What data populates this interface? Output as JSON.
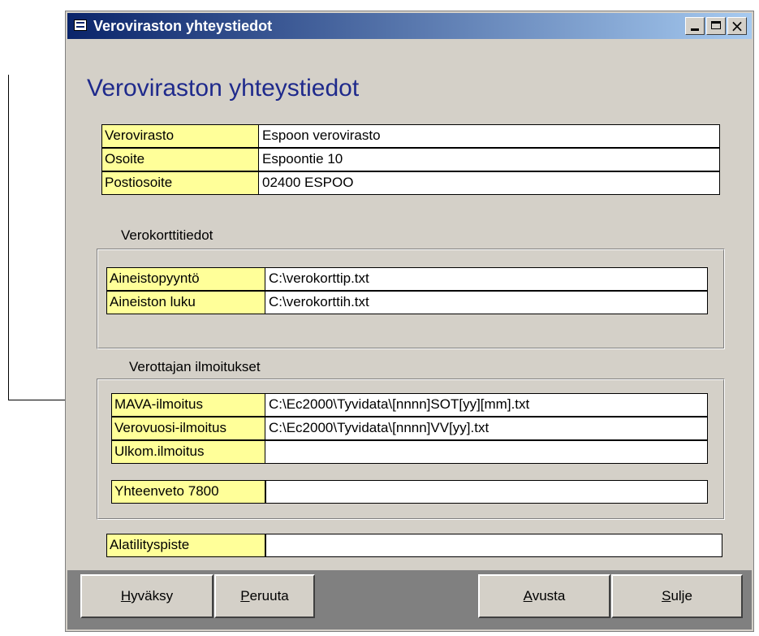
{
  "window": {
    "title": "Verovirastonyhteystiedot",
    "title_text": "Veroviraston yhteystiedot",
    "buttons": {
      "minimize": "_",
      "maximize": "□",
      "close": "×"
    }
  },
  "form": {
    "title": "Veroviraston yhteystiedot",
    "office": [
      {
        "label": "Verovirasto",
        "value": "Espoon verovirasto"
      },
      {
        "label": "Osoite",
        "value": "Espoontie 10"
      },
      {
        "label": "Postiosoite",
        "value": "02400 ESPOO"
      }
    ],
    "verokortti": {
      "heading": "Verokorttitiedot",
      "rows": [
        {
          "label": "Aineistopyyntö",
          "value": "C:\\verokorttip.txt"
        },
        {
          "label": "Aineiston luku",
          "value": "C:\\verokorttih.txt"
        }
      ]
    },
    "ilmoitukset": {
      "heading": "Verottajan ilmoitukset",
      "rows": [
        {
          "label": "MAVA-ilmoitus",
          "value": "C:\\Ec2000\\Tyvidata\\[nnnn]SOT[yy][mm].txt"
        },
        {
          "label": "Verovuosi-ilmoitus",
          "value": "C:\\Ec2000\\Tyvidata\\[nnnn]VV[yy].txt"
        },
        {
          "label": "Ulkom.ilmoitus",
          "value": ""
        }
      ],
      "summary": {
        "label": "Yhteenveto 7800",
        "value": ""
      }
    },
    "alatilitys": {
      "label": "Alatilityspiste",
      "value": ""
    }
  },
  "buttons": {
    "accept": {
      "hotkey": "H",
      "rest": "yväksy"
    },
    "cancel": {
      "hotkey": "P",
      "rest": "eruuta"
    },
    "help": {
      "hotkey": "A",
      "rest": "vusta"
    },
    "close": {
      "hotkey": "S",
      "rest": "ulje"
    }
  }
}
